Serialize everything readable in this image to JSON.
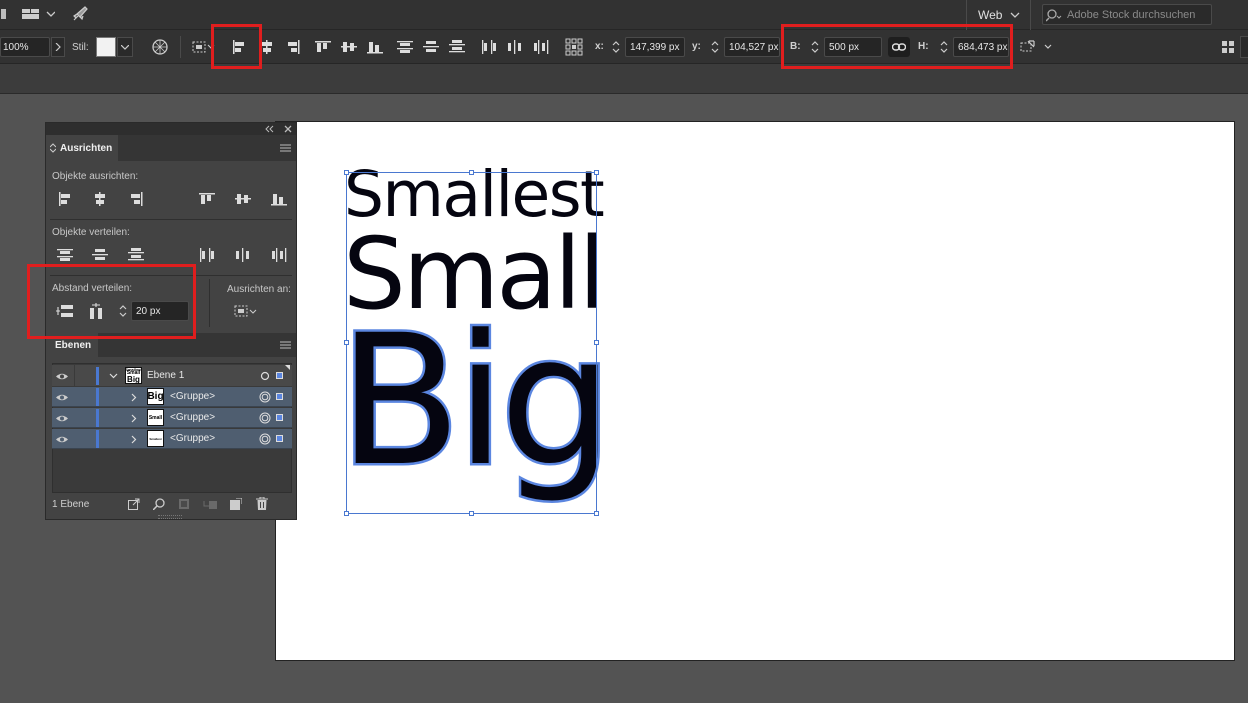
{
  "menubar": {
    "workspace": "Web",
    "search_placeholder": "Adobe Stock durchsuchen"
  },
  "controlbar": {
    "zoom": "100%",
    "style_label": "Stil:",
    "x_label": "x:",
    "x_value": "147,399 px",
    "y_label": "y:",
    "y_value": "104,527 px",
    "width_label": "B:",
    "width_value": "500 px",
    "height_label": "H:",
    "height_value": "684,473 px"
  },
  "align_panel": {
    "tab": "Ausrichten",
    "align_objects": "Objekte ausrichten:",
    "distribute_objects": "Objekte verteilen:",
    "distribute_spacing": "Abstand verteilen:",
    "spacing_value": "20 px",
    "align_to": "Ausrichten an:"
  },
  "layers_panel": {
    "tab": "Ebenen",
    "layer_name": "Ebene 1",
    "items": [
      {
        "name": "<Gruppe>",
        "thumb": "Big"
      },
      {
        "name": "<Gruppe>",
        "thumb": "Small"
      },
      {
        "name": "<Gruppe>",
        "thumb": "Smallest"
      }
    ],
    "footer": "1 Ebene"
  },
  "canvas": {
    "line1": "Smallest",
    "line2": "Small",
    "line3": "Big"
  },
  "colors": {
    "highlight": "#e01e1e",
    "selection": "#4a78d0",
    "layer_selected": "#4f5e70"
  }
}
